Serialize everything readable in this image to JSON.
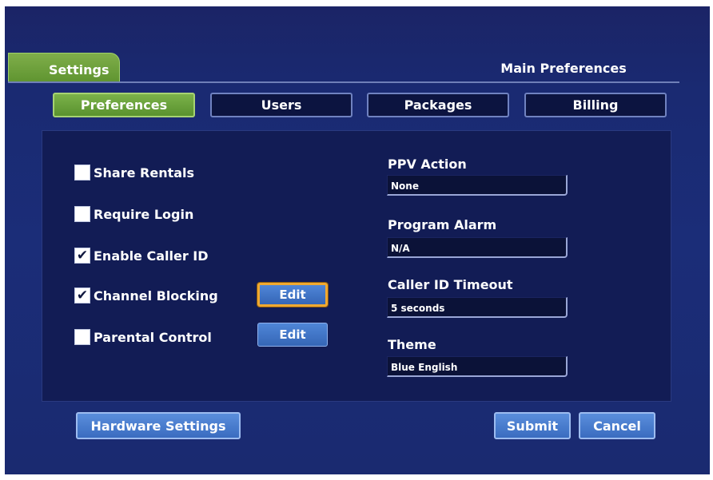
{
  "header": {
    "tab_label": "Settings",
    "title": "Main Preferences"
  },
  "tabs": [
    {
      "label": "Preferences",
      "active": true
    },
    {
      "label": "Users",
      "active": false
    },
    {
      "label": "Packages",
      "active": false
    },
    {
      "label": "Billing",
      "active": false
    }
  ],
  "options": [
    {
      "label": "Share Rentals",
      "checked": false,
      "mark": ""
    },
    {
      "label": "Require Login",
      "checked": false,
      "mark": ""
    },
    {
      "label": "Enable Caller ID",
      "checked": true,
      "mark": "✔"
    },
    {
      "label": "Channel Blocking",
      "checked": true,
      "mark": "✔"
    },
    {
      "label": "Parental Control",
      "checked": false,
      "mark": ""
    }
  ],
  "edit_buttons": {
    "channel_blocking": "Edit",
    "parental_control": "Edit"
  },
  "fields": [
    {
      "label": "PPV Action",
      "value": "None"
    },
    {
      "label": "Program Alarm",
      "value": "N/A"
    },
    {
      "label": "Caller ID Timeout",
      "value": "5 seconds"
    },
    {
      "label": "Theme",
      "value": "Blue English"
    }
  ],
  "footer": {
    "hardware_label": "Hardware Settings",
    "submit_label": "Submit",
    "cancel_label": "Cancel"
  },
  "colors": {
    "background": "#1b2d78",
    "active_tab": "#6aa33a",
    "button": "#4a7fd0",
    "focus_ring": "#f0a830"
  }
}
